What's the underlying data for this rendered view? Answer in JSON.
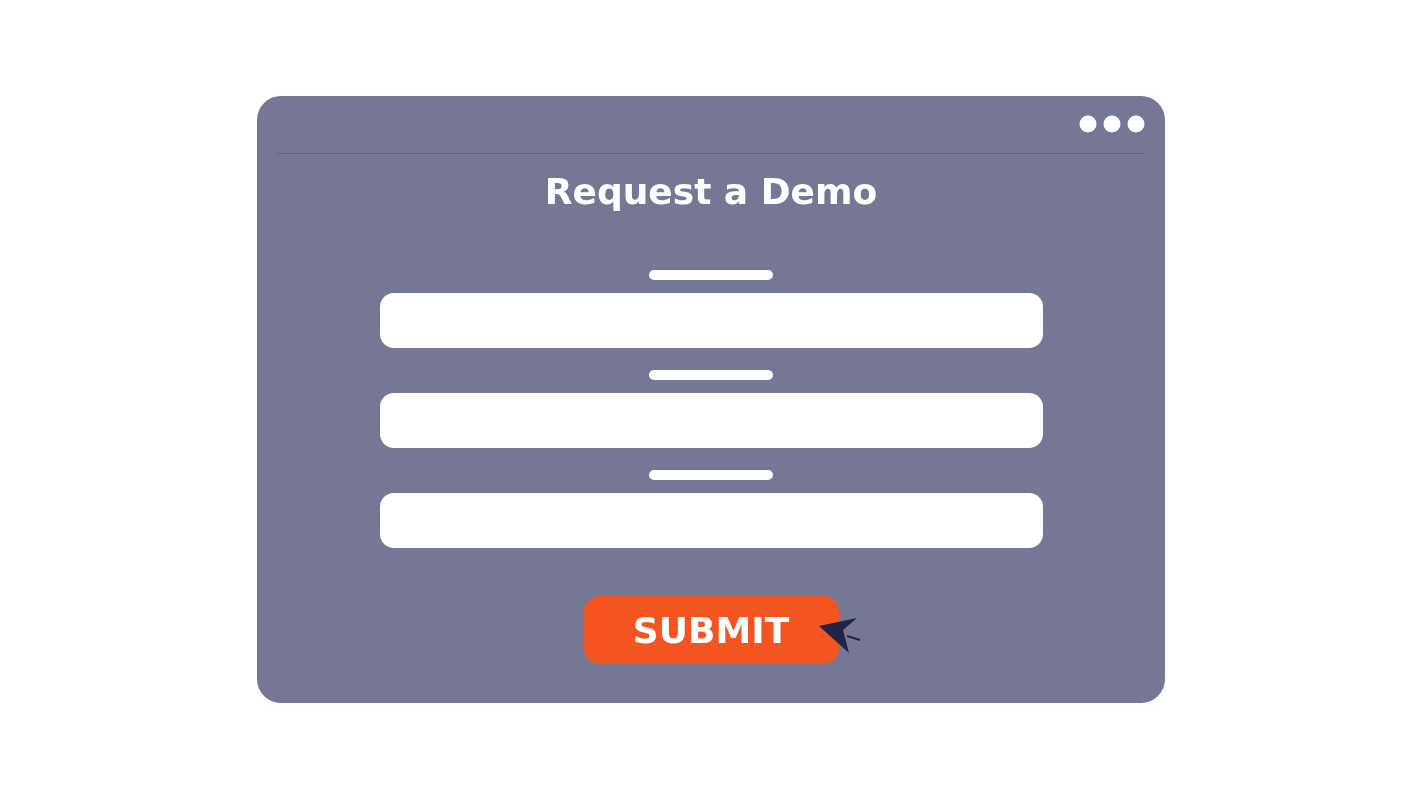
{
  "window": {
    "title": "Request a Demo"
  },
  "fields": [
    {
      "kind": "text"
    },
    {
      "kind": "text"
    },
    {
      "kind": "text"
    }
  ],
  "submit": {
    "label": "SUBMIT"
  }
}
